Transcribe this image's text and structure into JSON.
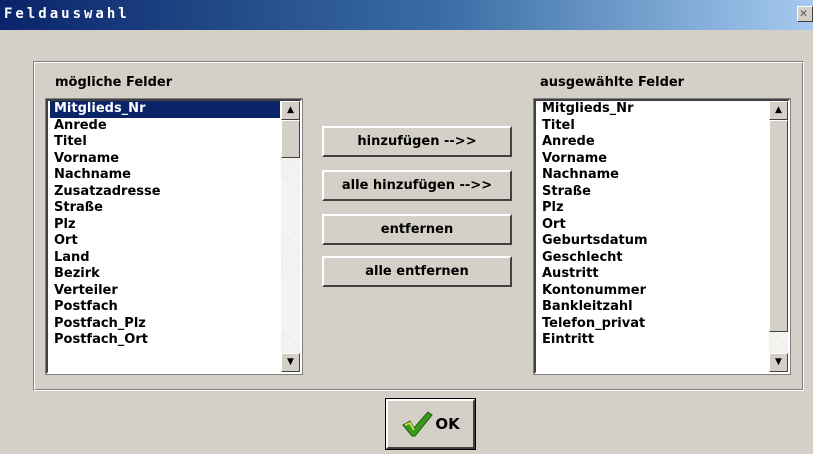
{
  "window": {
    "title": "Feldauswahl",
    "close_glyph": "✕"
  },
  "available": {
    "label": "mögliche Felder",
    "items": [
      "Mitglieds_Nr",
      "Anrede",
      "Titel",
      "Vorname",
      "Nachname",
      "Zusatzadresse",
      "Straße",
      "Plz",
      "Ort",
      "Land",
      "Bezirk",
      "Verteiler",
      "Postfach",
      "Postfach_Plz",
      "Postfach_Ort"
    ],
    "selected_index": 0
  },
  "selected": {
    "label": "ausgewählte Felder",
    "items": [
      "Mitglieds_Nr",
      "Titel",
      "Anrede",
      "Vorname",
      "Nachname",
      "Straße",
      "Plz",
      "Ort",
      "Geburtsdatum",
      "Geschlecht",
      "Austritt",
      "Kontonummer",
      "Bankleitzahl",
      "Telefon_privat",
      "Eintritt"
    ]
  },
  "buttons": {
    "add": "hinzufügen -->>",
    "add_all": "alle hinzufügen -->>",
    "remove": "entfernen",
    "remove_all": "alle entfernen",
    "ok": "OK"
  },
  "icons": {
    "ok": "checkmark-icon",
    "scroll_up": "▲",
    "scroll_down": "▼"
  },
  "colors": {
    "title_gradient_start": "#0a246a",
    "selection": "#0a246a",
    "checkmark_green": "#3a9a1e",
    "checkmark_yellow": "#c8d84a"
  }
}
